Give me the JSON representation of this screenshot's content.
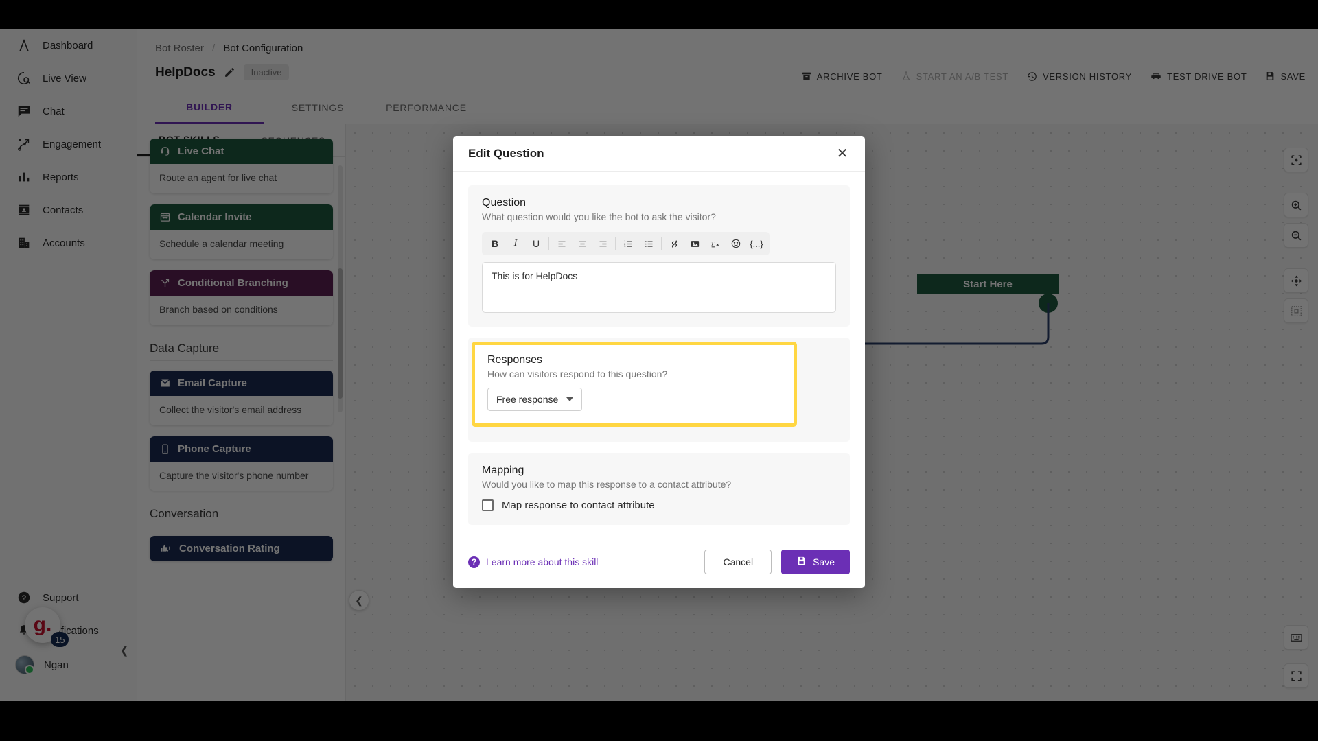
{
  "nav": {
    "items": [
      {
        "label": "Dashboard",
        "icon": "logo-icon"
      },
      {
        "label": "Live View",
        "icon": "live-view-icon"
      },
      {
        "label": "Chat",
        "icon": "chat-icon"
      },
      {
        "label": "Engagement",
        "icon": "engagement-icon"
      },
      {
        "label": "Reports",
        "icon": "reports-icon"
      },
      {
        "label": "Contacts",
        "icon": "contacts-icon"
      },
      {
        "label": "Accounts",
        "icon": "accounts-icon"
      }
    ],
    "support": "Support",
    "notifications": "Notifications",
    "user": "Ngan",
    "chat_widget_label": "g.",
    "chat_widget_badge": "15"
  },
  "header": {
    "breadcrumb_root": "Bot Roster",
    "breadcrumb_sep": "/",
    "breadcrumb_current": "Bot Configuration",
    "bot_name": "HelpDocs",
    "status_badge": "Inactive",
    "tabs": [
      {
        "label": "BUILDER",
        "active": true
      },
      {
        "label": "SETTINGS",
        "active": false
      },
      {
        "label": "PERFORMANCE",
        "active": false
      }
    ],
    "tools": [
      {
        "label": "ARCHIVE BOT",
        "icon": "archive-icon",
        "dim": false
      },
      {
        "label": "START AN A/B TEST",
        "icon": "flask-icon",
        "dim": true
      },
      {
        "label": "VERSION HISTORY",
        "icon": "history-icon",
        "dim": false
      },
      {
        "label": "TEST DRIVE BOT",
        "icon": "car-icon",
        "dim": false
      },
      {
        "label": "SAVE",
        "icon": "floppy-icon",
        "dim": false
      }
    ]
  },
  "skills_panel": {
    "tabs": [
      {
        "label": "BOT SKILLS",
        "active": true
      },
      {
        "label": "SEQUENCES",
        "active": false
      }
    ],
    "cards": [
      {
        "title": "Live Chat",
        "desc": "Route an agent for live chat",
        "color": "#1d5a3f",
        "icon": "headset-icon"
      },
      {
        "title": "Calendar Invite",
        "desc": "Schedule a calendar meeting",
        "color": "#1d5a3f",
        "icon": "calendar-icon"
      },
      {
        "title": "Conditional Branching",
        "desc": "Branch based on conditions",
        "color": "#5c1f52",
        "icon": "branch-icon"
      }
    ],
    "section_data_capture": "Data Capture",
    "data_capture_cards": [
      {
        "title": "Email Capture",
        "desc": "Collect the visitor's email address",
        "color": "#1b2a52",
        "icon": "envelope-icon"
      },
      {
        "title": "Phone Capture",
        "desc": "Capture the visitor's phone number",
        "color": "#1b2a52",
        "icon": "phone-icon"
      }
    ],
    "section_conversation": "Conversation",
    "conversation_cards": [
      {
        "title": "Conversation Rating",
        "desc": "",
        "color": "#1b2a52",
        "icon": "thumbs-icon"
      }
    ]
  },
  "canvas": {
    "start_node_label": "Start Here",
    "tools": [
      {
        "icon": "focus-icon"
      },
      {
        "icon": "zoom-in-icon"
      },
      {
        "icon": "zoom-out-icon"
      },
      {
        "icon": "pan-icon"
      },
      {
        "icon": "fit-screen-icon"
      },
      {
        "icon": "keyboard-icon"
      },
      {
        "icon": "fullscreen-icon"
      }
    ]
  },
  "modal": {
    "title": "Edit Question",
    "close_label": "✕",
    "question": {
      "heading": "Question",
      "subtext": "What question would you like the bot to ask the visitor?",
      "value": "This is for HelpDocs",
      "toolbar": [
        {
          "icon": "bold-icon",
          "glyph": "B"
        },
        {
          "icon": "italic-icon",
          "glyph": "I"
        },
        {
          "icon": "underline-icon",
          "glyph": "U"
        },
        {
          "icon": "align-left-icon",
          "glyph": ""
        },
        {
          "icon": "align-center-icon",
          "glyph": ""
        },
        {
          "icon": "align-right-icon",
          "glyph": ""
        },
        {
          "icon": "ordered-list-icon",
          "glyph": ""
        },
        {
          "icon": "bullet-list-icon",
          "glyph": ""
        },
        {
          "icon": "link-icon",
          "glyph": ""
        },
        {
          "icon": "image-icon",
          "glyph": ""
        },
        {
          "icon": "clear-format-icon",
          "glyph": ""
        },
        {
          "icon": "emoji-icon",
          "glyph": ""
        },
        {
          "icon": "variable-icon",
          "glyph": "{...}"
        }
      ]
    },
    "responses": {
      "heading": "Responses",
      "subtext": "How can visitors respond to this question?",
      "selected_option": "Free response",
      "highlight_color": "#FFD642"
    },
    "mapping": {
      "heading": "Mapping",
      "subtext": "Would you like to map this response to a contact attribute?",
      "checkbox_label": "Map response to contact attribute",
      "checked": false
    },
    "footer": {
      "learn_more": "Learn more about this skill",
      "cancel_label": "Cancel",
      "save_label": "Save",
      "accent_color": "#6b2fb5"
    }
  }
}
